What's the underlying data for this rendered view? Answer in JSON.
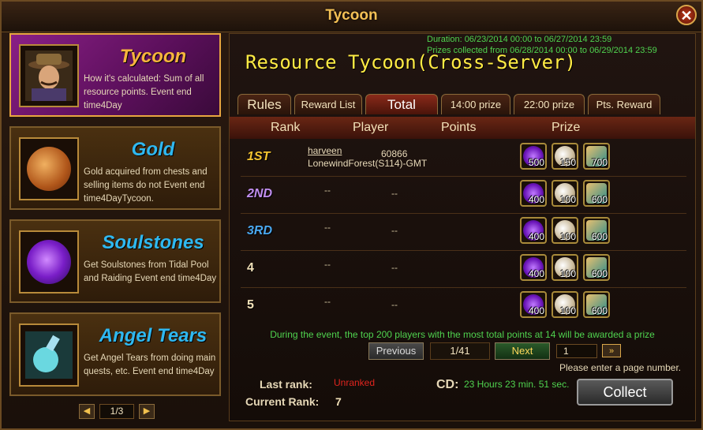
{
  "window": {
    "title": "Tycoon",
    "close_icon": "close-icon"
  },
  "sidebar": {
    "categories": [
      {
        "name": "Tycoon",
        "desc": "How it's calculated: Sum of all resource points. Event end time4Day",
        "icon": "tycoon-portrait-icon",
        "active": true,
        "name_color": "#f7b43d"
      },
      {
        "name": "Gold",
        "desc": "Gold acquired from chests and selling items do not Event end time4DayTycoon.",
        "icon": "gold-coin-icon",
        "active": false,
        "name_color": "#2fb8f0"
      },
      {
        "name": "Soulstones",
        "desc": "Get Soulstones from Tidal Pool and Raiding Event end time4Day",
        "icon": "soulstone-orb-icon",
        "active": false,
        "name_color": "#2fb8f0"
      },
      {
        "name": "Angel Tears",
        "desc": "Get Angel Tears from doing main quests, etc. Event end time4Day",
        "icon": "angel-tears-potion-icon",
        "active": false,
        "name_color": "#2fb8f0"
      }
    ],
    "pager": {
      "current": "1/3"
    }
  },
  "event": {
    "duration": "Duration: 06/23/2014 00:00 to 06/27/2014 23:59",
    "prizes_collected": "Prizes collected from 06/28/2014 00:00 to 06/29/2014 23:59",
    "title": "Resource Tycoon(Cross-Server)"
  },
  "tabs": [
    {
      "label": "Rules",
      "active": false
    },
    {
      "label": "Reward List",
      "active": false
    },
    {
      "label": "Total",
      "active": true
    },
    {
      "label": "14:00 prize",
      "active": false
    },
    {
      "label": "22:00 prize",
      "active": false
    },
    {
      "label": "Pts. Reward",
      "active": false
    }
  ],
  "table": {
    "headers": {
      "rank": "Rank",
      "player": "Player",
      "points": "Points",
      "prize": "Prize"
    },
    "rows": [
      {
        "rank": "1ST",
        "rank_color": "#f5c430",
        "player_name": "harveen",
        "player_server": "LonewindForest(S114)-GMT",
        "points": "60866",
        "prizes": [
          "500",
          "150",
          "700"
        ]
      },
      {
        "rank": "2ND",
        "rank_color": "#c08ef0",
        "player_name": "--",
        "player_server": "",
        "points": "--",
        "prizes": [
          "400",
          "100",
          "600"
        ]
      },
      {
        "rank": "3RD",
        "rank_color": "#4aa8f0",
        "player_name": "--",
        "player_server": "",
        "points": "--",
        "prizes": [
          "400",
          "100",
          "600"
        ]
      },
      {
        "rank": "4",
        "rank_color": "#f2e1b8",
        "player_name": "--",
        "player_server": "",
        "points": "--",
        "prizes": [
          "400",
          "100",
          "600"
        ]
      },
      {
        "rank": "5",
        "rank_color": "#f2e1b8",
        "player_name": "--",
        "player_server": "",
        "points": "--",
        "prizes": [
          "400",
          "100",
          "600"
        ]
      }
    ],
    "prize_icons": [
      "soulstone-icon",
      "pearl-icon",
      "angel-tears-icon"
    ]
  },
  "info": "During the event, the top 200 players with the most total points at 14 will be awarded a prize",
  "pagination": {
    "previous": "Previous",
    "page": "1/41",
    "next": "Next",
    "input_value": "1",
    "go": "»",
    "hint": "Please enter a page number."
  },
  "footer": {
    "last_rank_label": "Last rank:",
    "last_rank_value": "Unranked",
    "cd_label": "CD:",
    "cd_value": "23 Hours 23 min. 51 sec.",
    "current_rank_label": "Current Rank:",
    "current_rank_value": "7",
    "collect": "Collect"
  }
}
